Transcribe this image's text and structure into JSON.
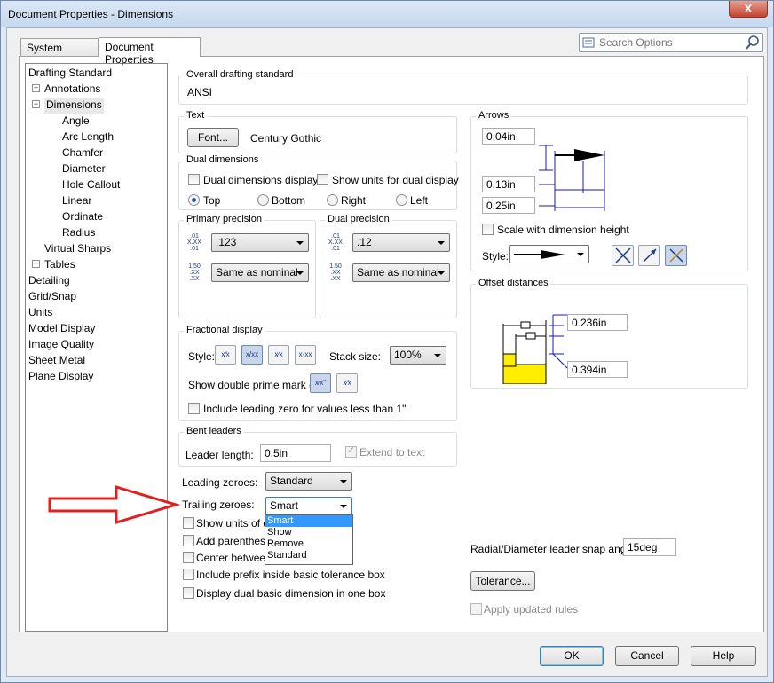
{
  "window": {
    "title": "Document Properties - Dimensions",
    "close_label": "X"
  },
  "tabs": [
    {
      "label": "System Options"
    },
    {
      "label": "Document Properties"
    }
  ],
  "search": {
    "placeholder": "Search Options"
  },
  "tree": [
    {
      "label": "Drafting Standard"
    },
    {
      "label": "Annotations"
    },
    {
      "label": "Dimensions"
    },
    {
      "label": "Angle"
    },
    {
      "label": "Arc Length"
    },
    {
      "label": "Chamfer"
    },
    {
      "label": "Diameter"
    },
    {
      "label": "Hole Callout"
    },
    {
      "label": "Linear"
    },
    {
      "label": "Ordinate"
    },
    {
      "label": "Radius"
    },
    {
      "label": "Virtual Sharps"
    },
    {
      "label": "Tables"
    },
    {
      "label": "Detailing"
    },
    {
      "label": "Grid/Snap"
    },
    {
      "label": "Units"
    },
    {
      "label": "Model Display"
    },
    {
      "label": "Image Quality"
    },
    {
      "label": "Sheet Metal"
    },
    {
      "label": "Plane Display"
    }
  ],
  "overall": {
    "label": "Overall drafting standard",
    "value": "ANSI"
  },
  "text": {
    "label": "Text",
    "font_button": "Font...",
    "font_name": "Century Gothic"
  },
  "dual": {
    "label": "Dual dimensions",
    "display": "Dual dimensions display",
    "show_units": "Show units for dual display",
    "top": "Top",
    "bottom": "Bottom",
    "right": "Right",
    "left": "Left"
  },
  "primary_precision": {
    "label": "Primary precision",
    "value": ".123",
    "tol": "Same as nominal",
    "icon1": ".01 X.XX .01",
    "icon2": "1.50 .XX .XX"
  },
  "dual_precision": {
    "label": "Dual precision",
    "value": ".12",
    "tol": "Same as nominal",
    "icon1": ".01 X.XX .01",
    "icon2": "1.50 .XX .XX"
  },
  "fractional": {
    "label": "Fractional display",
    "style_label": "Style:",
    "style_icons": [
      "x⁄x",
      "x/xx",
      "x⁄x",
      "x-xx"
    ],
    "stack_label": "Stack size:",
    "stack_value": "100%",
    "double_prime": "Show double prime mark (\"):",
    "prime_icons": [
      "x⁄x\"",
      "x⁄x"
    ],
    "leading_zero": "Include leading zero for values less than 1\""
  },
  "bent": {
    "label": "Bent leaders",
    "length_label": "Leader length:",
    "length_value": "0.5in",
    "extend": "Extend to text"
  },
  "leading_zeroes": {
    "label": "Leading zeroes:",
    "value": "Standard"
  },
  "trailing_zeroes": {
    "label": "Trailing zeroes:",
    "value": "Smart",
    "options": [
      "Smart",
      "Show",
      "Remove",
      "Standard"
    ]
  },
  "options": [
    {
      "label": "Show units of di"
    },
    {
      "label": "Add parenthese"
    },
    {
      "label": "Center between"
    },
    {
      "label": "Include prefix inside basic tolerance box"
    },
    {
      "label": "Display dual basic dimension in one box"
    }
  ],
  "arrows": {
    "label": "Arrows",
    "v1": "0.04in",
    "v2": "0.13in",
    "v3": "0.25in",
    "scale": "Scale with dimension height",
    "style_label": "Style:"
  },
  "offset": {
    "label": "Offset distances",
    "v1": "0.236in",
    "v2": "0.394in"
  },
  "radial": {
    "label": "Radial/Diameter leader snap angle:",
    "value": "15deg"
  },
  "tolerance_button": "Tolerance...",
  "apply_updated": "Apply updated rules",
  "buttons": {
    "ok": "OK",
    "cancel": "Cancel",
    "help": "Help"
  },
  "colors": {
    "accent": "#3399ff",
    "arrow": "#e02020",
    "part_fill": "#ffee00"
  }
}
